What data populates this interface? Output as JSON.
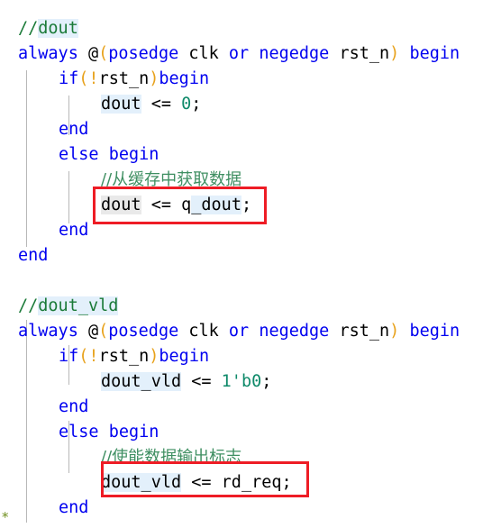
{
  "editor": {
    "language": "verilog",
    "colors": {
      "background": "#ffffff",
      "keyword": "#0000f0",
      "comment": "#1a7a38",
      "comment_cjk": "#3f8f62",
      "paren": "#e8a21c",
      "number": "#0f8a6a",
      "identifier": "#000000",
      "occurrence_highlight": "#e3f0fb",
      "selection_highlight": "#e9e9e9",
      "indent_guide": "#b8b8b8",
      "annotation_box": "#ee1c25"
    },
    "bottom_marker": "*"
  },
  "code": {
    "lines": [
      {
        "id": "l1",
        "indent": 0,
        "text": "//dout"
      },
      {
        "id": "l2",
        "indent": 0,
        "text": "always @(posedge clk or negedge rst_n) begin"
      },
      {
        "id": "l3",
        "indent": 1,
        "text": "if(!rst_n)begin"
      },
      {
        "id": "l4",
        "indent": 2,
        "text": "dout <= 0;"
      },
      {
        "id": "l5",
        "indent": 1,
        "text": "end"
      },
      {
        "id": "l6",
        "indent": 1,
        "text": "else begin"
      },
      {
        "id": "l7",
        "indent": 2,
        "text": "//从缓存中获取数据"
      },
      {
        "id": "l8",
        "indent": 2,
        "text": "dout <= q_dout;"
      },
      {
        "id": "l9",
        "indent": 1,
        "text": "end"
      },
      {
        "id": "l10",
        "indent": 0,
        "text": "end"
      },
      {
        "id": "l11",
        "indent": 0,
        "text": ""
      },
      {
        "id": "l12",
        "indent": 0,
        "text": "//dout_vld"
      },
      {
        "id": "l13",
        "indent": 0,
        "text": "always @(posedge clk or negedge rst_n) begin"
      },
      {
        "id": "l14",
        "indent": 1,
        "text": "if(!rst_n)begin"
      },
      {
        "id": "l15",
        "indent": 2,
        "text": "dout_vld <= 1'b0;"
      },
      {
        "id": "l16",
        "indent": 1,
        "text": "end"
      },
      {
        "id": "l17",
        "indent": 1,
        "text": "else begin"
      },
      {
        "id": "l18",
        "indent": 2,
        "text": "//使能数据输出标志"
      },
      {
        "id": "l19",
        "indent": 2,
        "text": "dout_vld <= rd_req;"
      },
      {
        "id": "l20",
        "indent": 1,
        "text": "end"
      }
    ],
    "tokens": {
      "comment_slashes": "//",
      "comment_dout": "dout",
      "comment_dout_vld": "dout_vld",
      "kw_always": "always",
      "at": "@",
      "lparen": "(",
      "rparen": ")",
      "kw_posedge": "posedge",
      "id_clk": "clk",
      "kw_or": "or",
      "kw_negedge": "negedge",
      "id_rst_n": "rst_n",
      "kw_begin": "begin",
      "kw_if": "if",
      "bang": "!",
      "kw_end": "end",
      "kw_else": "else",
      "id_dout": "dout",
      "id_dout_vld": "dout_vld",
      "assign": "<=",
      "num_zero": "0",
      "num_1b0": "1'b0",
      "id_q_dout_prefix": "q",
      "id_q_dout_suffix": "_dout",
      "id_rd_req": "rd_req",
      "semicolon": ";",
      "space": " ",
      "comment_cn_1": "从缓存中获取数据",
      "comment_cn_2": "使能数据输出标志"
    }
  },
  "annotations": [
    {
      "id": "box-1",
      "target_line": "l8",
      "label": "dout <= q_dout;"
    },
    {
      "id": "box-2",
      "target_line": "l19",
      "label": "dout_vld <= rd_req;"
    }
  ]
}
